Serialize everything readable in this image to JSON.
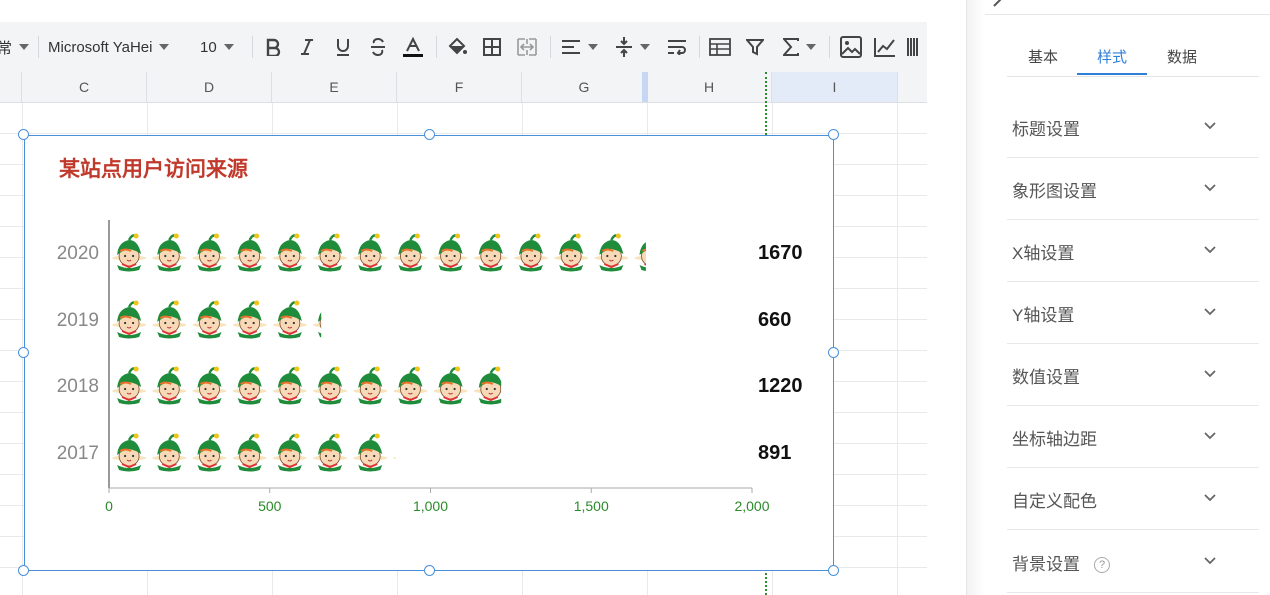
{
  "toolbar": {
    "style_partial": "常",
    "font_family": "Microsoft YaHei",
    "font_size": "10",
    "icons": [
      "bold-icon",
      "italic-icon",
      "underline-icon",
      "strikethrough-icon",
      "font-color-icon",
      "fill-color-icon",
      "borders-icon",
      "merge-cells-icon",
      "align-icon",
      "vertical-align-icon",
      "wrap-text-icon",
      "table-icon",
      "filter-icon",
      "sum-icon",
      "image-icon",
      "chart-icon",
      "barcode-icon"
    ]
  },
  "columns": [
    "C",
    "D",
    "E",
    "F",
    "G",
    "H",
    "I"
  ],
  "chart": {
    "title": "某站点用户访问来源"
  },
  "chart_data": {
    "type": "bar",
    "subtype": "pictorial-horizontal",
    "title": "某站点用户访问来源",
    "categories": [
      "2020",
      "2019",
      "2018",
      "2017"
    ],
    "values": [
      1670,
      660,
      1220,
      891
    ],
    "value_labels": [
      "1670",
      "660",
      "1220",
      "891"
    ],
    "xlim": [
      0,
      2000
    ],
    "x_ticks": [
      "0",
      "500",
      "1,000",
      "1,500",
      "2,000"
    ],
    "x_tick_values": [
      0,
      500,
      1000,
      1500,
      2000
    ],
    "grid": false,
    "legend": "none",
    "colors": {
      "title": "#c0392b",
      "tick_labels": "#2a8a2a",
      "category_labels": "#888888",
      "value_labels": "#111111",
      "symbol_hat": "#1e8c3a",
      "symbol_face": "#f7d9b8"
    }
  },
  "panel": {
    "tabs": [
      {
        "label": "基本",
        "active": false
      },
      {
        "label": "样式",
        "active": true
      },
      {
        "label": "数据",
        "active": false
      }
    ],
    "sections": [
      {
        "label": "标题设置"
      },
      {
        "label": "象形图设置"
      },
      {
        "label": "X轴设置"
      },
      {
        "label": "Y轴设置"
      },
      {
        "label": "数值设置"
      },
      {
        "label": "坐标轴边距"
      },
      {
        "label": "自定义配色"
      },
      {
        "label": "背景设置",
        "help": true
      }
    ],
    "help_glyph": "?"
  },
  "colors": {
    "accent": "#2f7fd8",
    "selection": "#4a90d9"
  }
}
